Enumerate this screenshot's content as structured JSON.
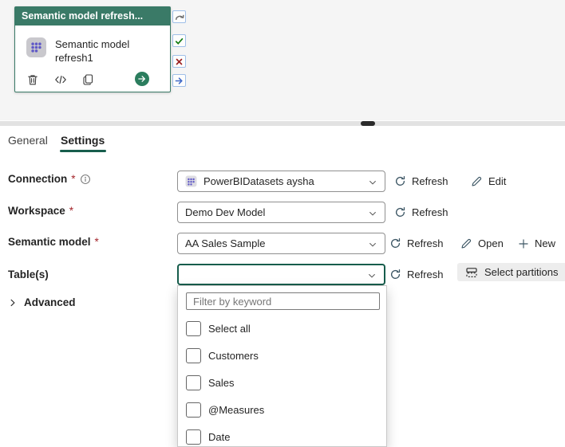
{
  "colors": {
    "accent_teal": "#3a7a67",
    "focus_teal": "#175d4c",
    "success_green": "#0e7a0e",
    "fail_red": "#9c2121",
    "completion_blue": "#3f69c8",
    "required_red": "#a4262c"
  },
  "canvas": {
    "activity_card": {
      "header_title": "Semantic model refresh...",
      "body_title": "Semantic model refresh1"
    }
  },
  "tabs": {
    "general": "General",
    "settings": "Settings"
  },
  "form": {
    "connection": {
      "label": "Connection",
      "required": "*",
      "value": "PowerBIDatasets aysha",
      "refresh_label": "Refresh",
      "edit_label": "Edit"
    },
    "workspace": {
      "label": "Workspace",
      "required": "*",
      "value": "Demo Dev Model",
      "refresh_label": "Refresh"
    },
    "semantic_model": {
      "label": "Semantic model",
      "required": "*",
      "value": "AA Sales Sample",
      "refresh_label": "Refresh",
      "open_label": "Open",
      "new_label": "New"
    },
    "tables": {
      "label": "Table(s)",
      "value": "",
      "refresh_label": "Refresh",
      "select_partitions_label": "Select partitions"
    },
    "advanced": {
      "label": "Advanced"
    }
  },
  "tables_dropdown": {
    "filter_placeholder": "Filter by keyword",
    "options": [
      "Select all",
      "Customers",
      "Sales",
      "@Measures",
      "Date"
    ]
  }
}
